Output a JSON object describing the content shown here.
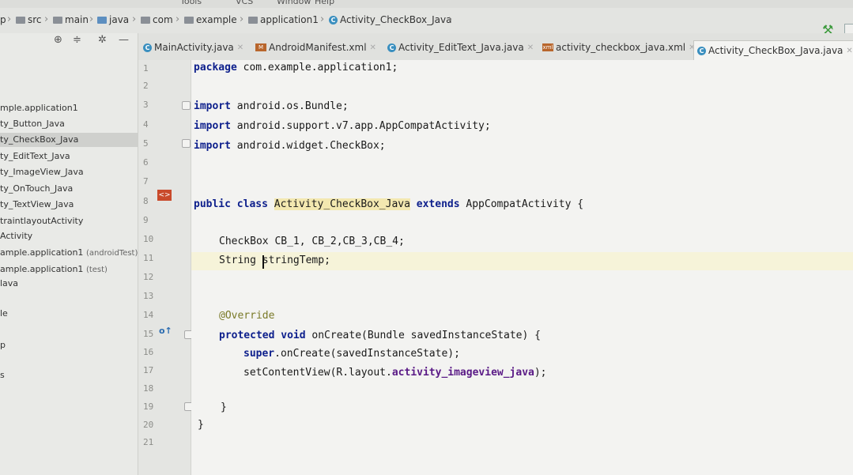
{
  "menubar": {
    "items": [
      "Tools",
      "VCS",
      "Window",
      "Help"
    ]
  },
  "breadcrumb": {
    "items": [
      "p",
      "src",
      "main",
      "java",
      "com",
      "example",
      "application1",
      "Activity_CheckBox_Java"
    ]
  },
  "project_panel": {
    "items": [
      {
        "label": "mple.application1",
        "suffix": ""
      },
      {
        "label": "ty_Button_Java",
        "suffix": ""
      },
      {
        "label": "ty_CheckBox_Java",
        "suffix": ""
      },
      {
        "label": "ty_EditText_Java",
        "suffix": ""
      },
      {
        "label": "ty_ImageView_Java",
        "suffix": ""
      },
      {
        "label": "ty_OnTouch_Java",
        "suffix": ""
      },
      {
        "label": "ty_TextView_Java",
        "suffix": ""
      },
      {
        "label": "traintlayoutActivity",
        "suffix": ""
      },
      {
        "label": "Activity",
        "suffix": ""
      },
      {
        "label": "ample.application1",
        "suffix": "(androidTest)"
      },
      {
        "label": "ample.application1",
        "suffix": "(test)"
      },
      {
        "label": "lava",
        "suffix": ""
      },
      {
        "label": "le",
        "suffix": ""
      },
      {
        "label": "p",
        "suffix": ""
      },
      {
        "label": "s",
        "suffix": ""
      }
    ]
  },
  "tabs": [
    {
      "label": "MainActivity.java"
    },
    {
      "label": "AndroidManifest.xml"
    },
    {
      "label": "Activity_EditText_Java.java"
    },
    {
      "label": "activity_checkbox_java.xml"
    },
    {
      "label": "Activity_CheckBox_Java.java"
    }
  ],
  "editor": {
    "line_numbers": [
      "1",
      "2",
      "3",
      "4",
      "5",
      "6",
      "7",
      "8",
      "9",
      "10",
      "11",
      "12",
      "13",
      "14",
      "15",
      "16",
      "17",
      "18",
      "19",
      "20",
      "21"
    ],
    "code": {
      "l1_kw": "package",
      "l1_rest": " com.example.application1;",
      "l3_kw": "import",
      "l3_rest": " android.os.Bundle;",
      "l4_kw": "import",
      "l4_rest": " android.support.v7.app.AppCompatActivity;",
      "l5_kw": "import",
      "l5_rest": " android.widget.CheckBox;",
      "l8_kw1": "public class",
      "l8_cls": "Activity_CheckBox_Java",
      "l8_kw2": "extends",
      "l8_rest": " AppCompatActivity {",
      "l10": "CheckBox CB_1, CB_2,CB_3,CB_4;",
      "l11_a": "String",
      "l11_b": "stringTemp;",
      "l14": "@Override",
      "l15_kw": "protected void",
      "l15_rest": " onCreate(Bundle savedInstanceState) {",
      "l16_kw": "super",
      "l16_rest": ".onCreate(savedInstanceState);",
      "l17_a": "setContentView(R.layout.",
      "l17_fld": "activity_imageview_java",
      "l17_b": ");",
      "l19": "}",
      "l20": "}"
    }
  },
  "colors": {
    "keyword": "#0d1f8c",
    "field": "#5a1a86",
    "annotation": "#7a7a28",
    "class_highlight": "#f3e8b0"
  }
}
